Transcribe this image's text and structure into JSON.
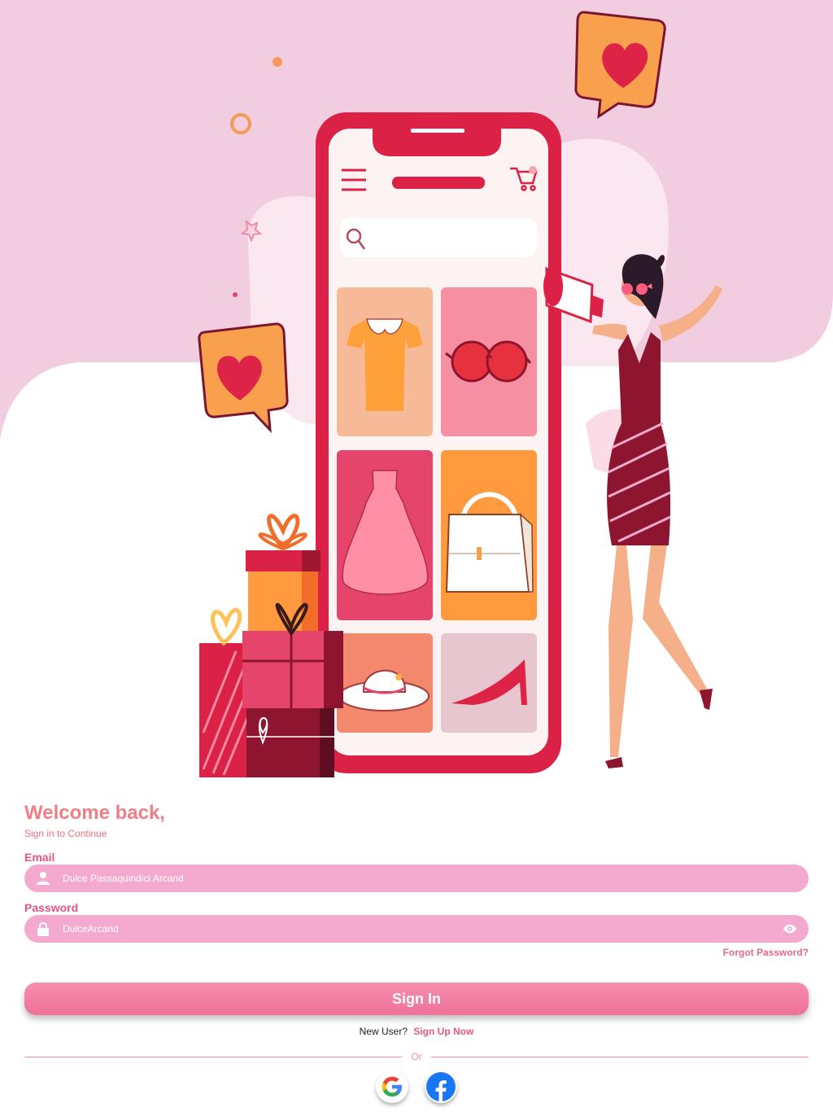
{
  "colors": {
    "accent": "#ef7f86",
    "field_bg": "#f3aace",
    "hero_bg": "#f2ccdf",
    "button": "#ee709a",
    "link": "#e8577f"
  },
  "login": {
    "title": "Welcome back,",
    "subtitle": "Sign in to Continue",
    "email": {
      "label": "Email",
      "value": "Dulce Passaquindici Arcand",
      "icon": "user-icon"
    },
    "password": {
      "label": "Password",
      "value": "DulceArcand",
      "icon": "lock-icon",
      "toggle_icon": "eye-icon"
    },
    "forgot_label": "Forgot Password?",
    "signin_label": "Sign In",
    "new_user_label": "New User?",
    "signup_label": "Sign Up Now",
    "divider_label": "Or",
    "social": [
      {
        "icon": "google-icon"
      },
      {
        "icon": "facebook-icon"
      }
    ]
  }
}
